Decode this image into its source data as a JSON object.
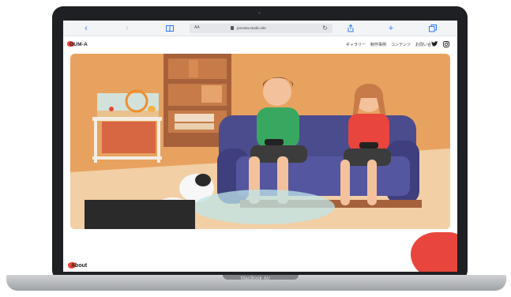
{
  "device": {
    "label": "MacBook Air"
  },
  "browser": {
    "icons": [
      "back-icon",
      "forward-icon",
      "book-icon",
      "share-icon",
      "new-tab-icon",
      "tabs-icon"
    ],
    "address": {
      "prefix": "AA",
      "url": "preview.studio.site"
    }
  },
  "site": {
    "logo": "OUM-A",
    "nav": [
      "ギャラリー",
      "制作事例",
      "コンテンツ",
      "お問い合せ"
    ],
    "social": [
      "twitter-icon",
      "instagram-icon"
    ],
    "section_title": "About"
  },
  "colors": {
    "brand_red": "#e8453c",
    "wall": "#e8a25f",
    "sofa": "#4b4c8e",
    "floor": "#f2cfa4"
  }
}
